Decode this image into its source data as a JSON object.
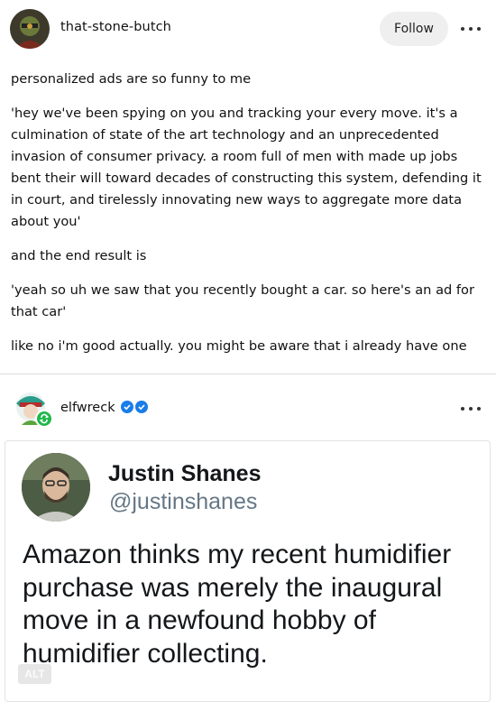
{
  "post": {
    "username": "that-stone-butch",
    "follow_label": "Follow",
    "paragraphs": [
      "personalized ads are so funny to me",
      "'hey we've been spying on you and tracking your every move. it's a culmination of state of the art technology and an unprecedented invasion of consumer privacy. a room full of men with made up jobs bent their will toward decades of constructing this system, defending it in court, and tirelessly innovating new ways to aggregate more data about you'",
      "and the end result is",
      "'yeah so uh we saw that you recently bought a car. so here's an ad for that car'",
      "like no i'm good actually. you might be aware that i already have one"
    ]
  },
  "reblog": {
    "username": "elfwreck",
    "tweet": {
      "name": "Justin Shanes",
      "handle": "@justinshanes",
      "text": "Amazon thinks my recent humidifier purchase was merely the inaugural move in a newfound hobby of humidifier collecting."
    },
    "alt_label": "ALT"
  },
  "colors": {
    "follow_bg": "#efefef",
    "verified_blue": "#1a7de8",
    "reblog_green": "#1fb84a",
    "handle_gray": "#657786"
  },
  "icons": [
    "more-options-icon",
    "verified-badge-icon",
    "reblog-icon"
  ]
}
